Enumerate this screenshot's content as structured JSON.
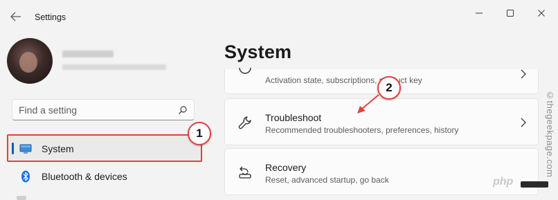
{
  "window": {
    "title": "Settings"
  },
  "search": {
    "placeholder": "Find a setting"
  },
  "nav": {
    "items": [
      {
        "label": "System",
        "icon": "monitor-icon",
        "active": true
      },
      {
        "label": "Bluetooth & devices",
        "icon": "bluetooth-icon",
        "active": false
      }
    ]
  },
  "main": {
    "title": "System",
    "cards": [
      {
        "title": "",
        "desc": "Activation state, subscriptions, product key",
        "icon": "key-icon"
      },
      {
        "title": "Troubleshoot",
        "desc": "Recommended troubleshooters, preferences, history",
        "icon": "wrench-icon"
      },
      {
        "title": "Recovery",
        "desc": "Reset, advanced startup, go back",
        "icon": "recovery-icon"
      }
    ]
  },
  "callouts": [
    "1",
    "2"
  ],
  "watermark": {
    "vertical": "©thegeekpage.com",
    "php": "php"
  },
  "colors": {
    "accent": "#005fb8",
    "annotation": "#e0423c",
    "background": "#f3f3f3",
    "card": "#fbfbfb"
  }
}
